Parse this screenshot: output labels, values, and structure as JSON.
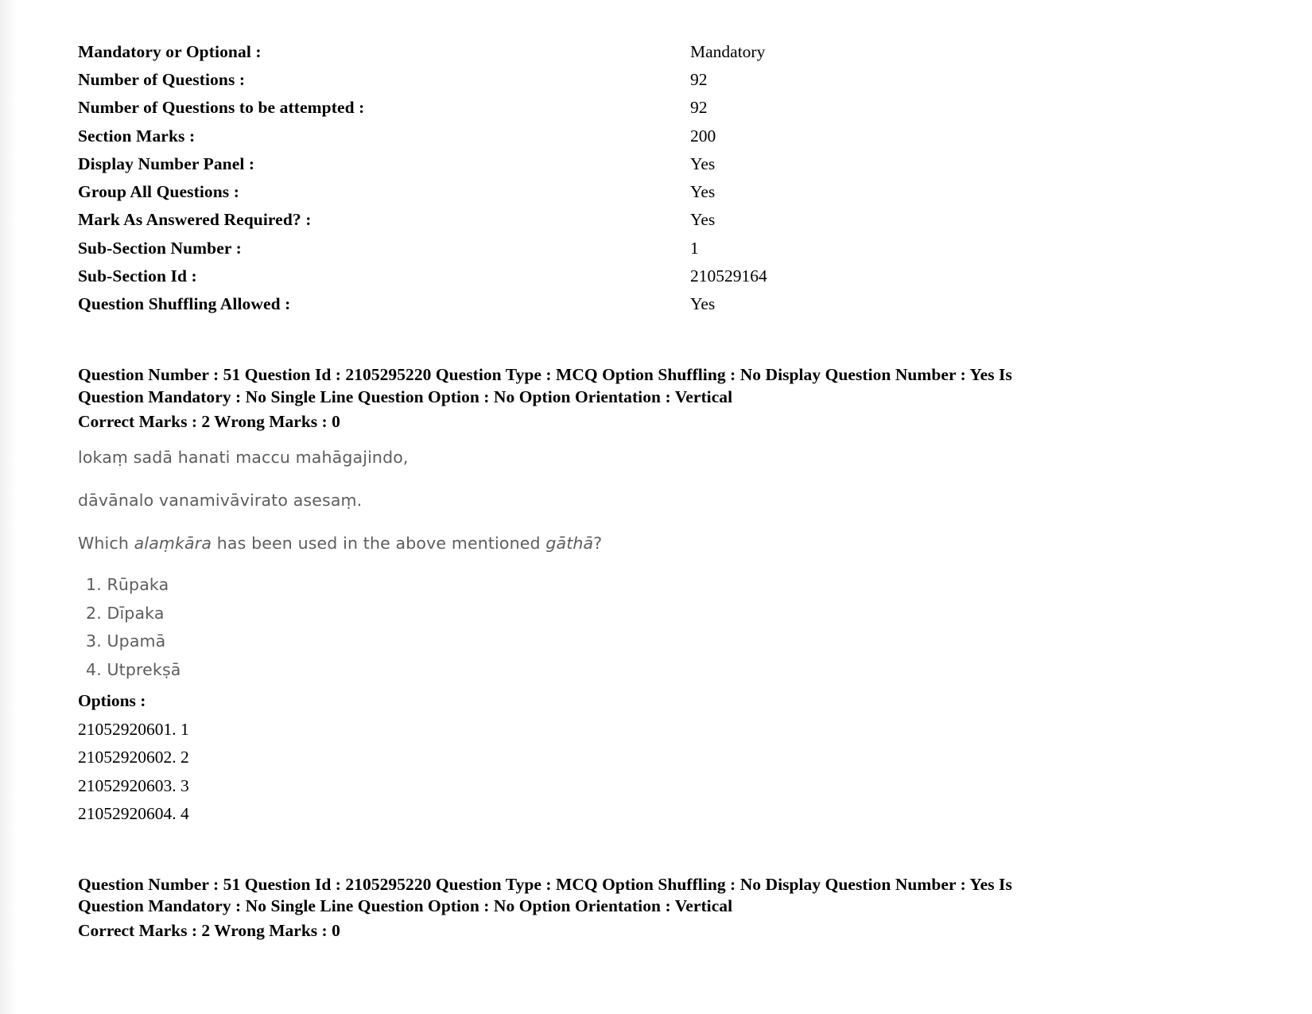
{
  "section_meta": {
    "rows": [
      {
        "label": "Mandatory or Optional :",
        "value": "Mandatory"
      },
      {
        "label": "Number of Questions :",
        "value": "92"
      },
      {
        "label": "Number of Questions to be attempted :",
        "value": "92"
      },
      {
        "label": "Section Marks :",
        "value": "200"
      },
      {
        "label": "Display Number Panel :",
        "value": "Yes"
      },
      {
        "label": "Group All Questions :",
        "value": "Yes"
      },
      {
        "label": "Mark As Answered Required? :",
        "value": "Yes"
      },
      {
        "label": "Sub-Section Number :",
        "value": "1"
      },
      {
        "label": "Sub-Section Id :",
        "value": "210529164"
      },
      {
        "label": "Question Shuffling Allowed :",
        "value": "Yes"
      }
    ]
  },
  "question": {
    "header_line1": "Question Number : 51 Question Id : 2105295220 Question Type : MCQ Option Shuffling : No Display Question Number : Yes Is",
    "header_line2": "Question Mandatory : No Single Line Question Option : No Option Orientation : Vertical",
    "marks_line": "Correct Marks : 2 Wrong Marks : 0",
    "gatha_line1": "lokaṃ sadā hanati maccu mahāgajindo,",
    "gatha_line2": "dāvānalo vanamivāvirato asesaṃ.",
    "prompt_part1": "Which ",
    "prompt_italic1": "alaṃkāra",
    "prompt_part2": " has been used in the above mentioned ",
    "prompt_italic2": "gāthā",
    "prompt_part3": "?",
    "choices": [
      "1. Rūpaka",
      "2. Dīpaka",
      "3. Upamā",
      "4. Utprekṣā"
    ],
    "options_label": "Options :",
    "option_ids": [
      "21052920601. 1",
      "21052920602. 2",
      "21052920603. 3",
      "21052920604. 4"
    ]
  },
  "question_repeat": {
    "header_line1": "Question Number : 51 Question Id : 2105295220 Question Type : MCQ Option Shuffling : No Display Question Number : Yes Is",
    "header_line2": "Question Mandatory : No Single Line Question Option : No Option Orientation : Vertical",
    "marks_line": "Correct Marks : 2 Wrong Marks : 0"
  }
}
